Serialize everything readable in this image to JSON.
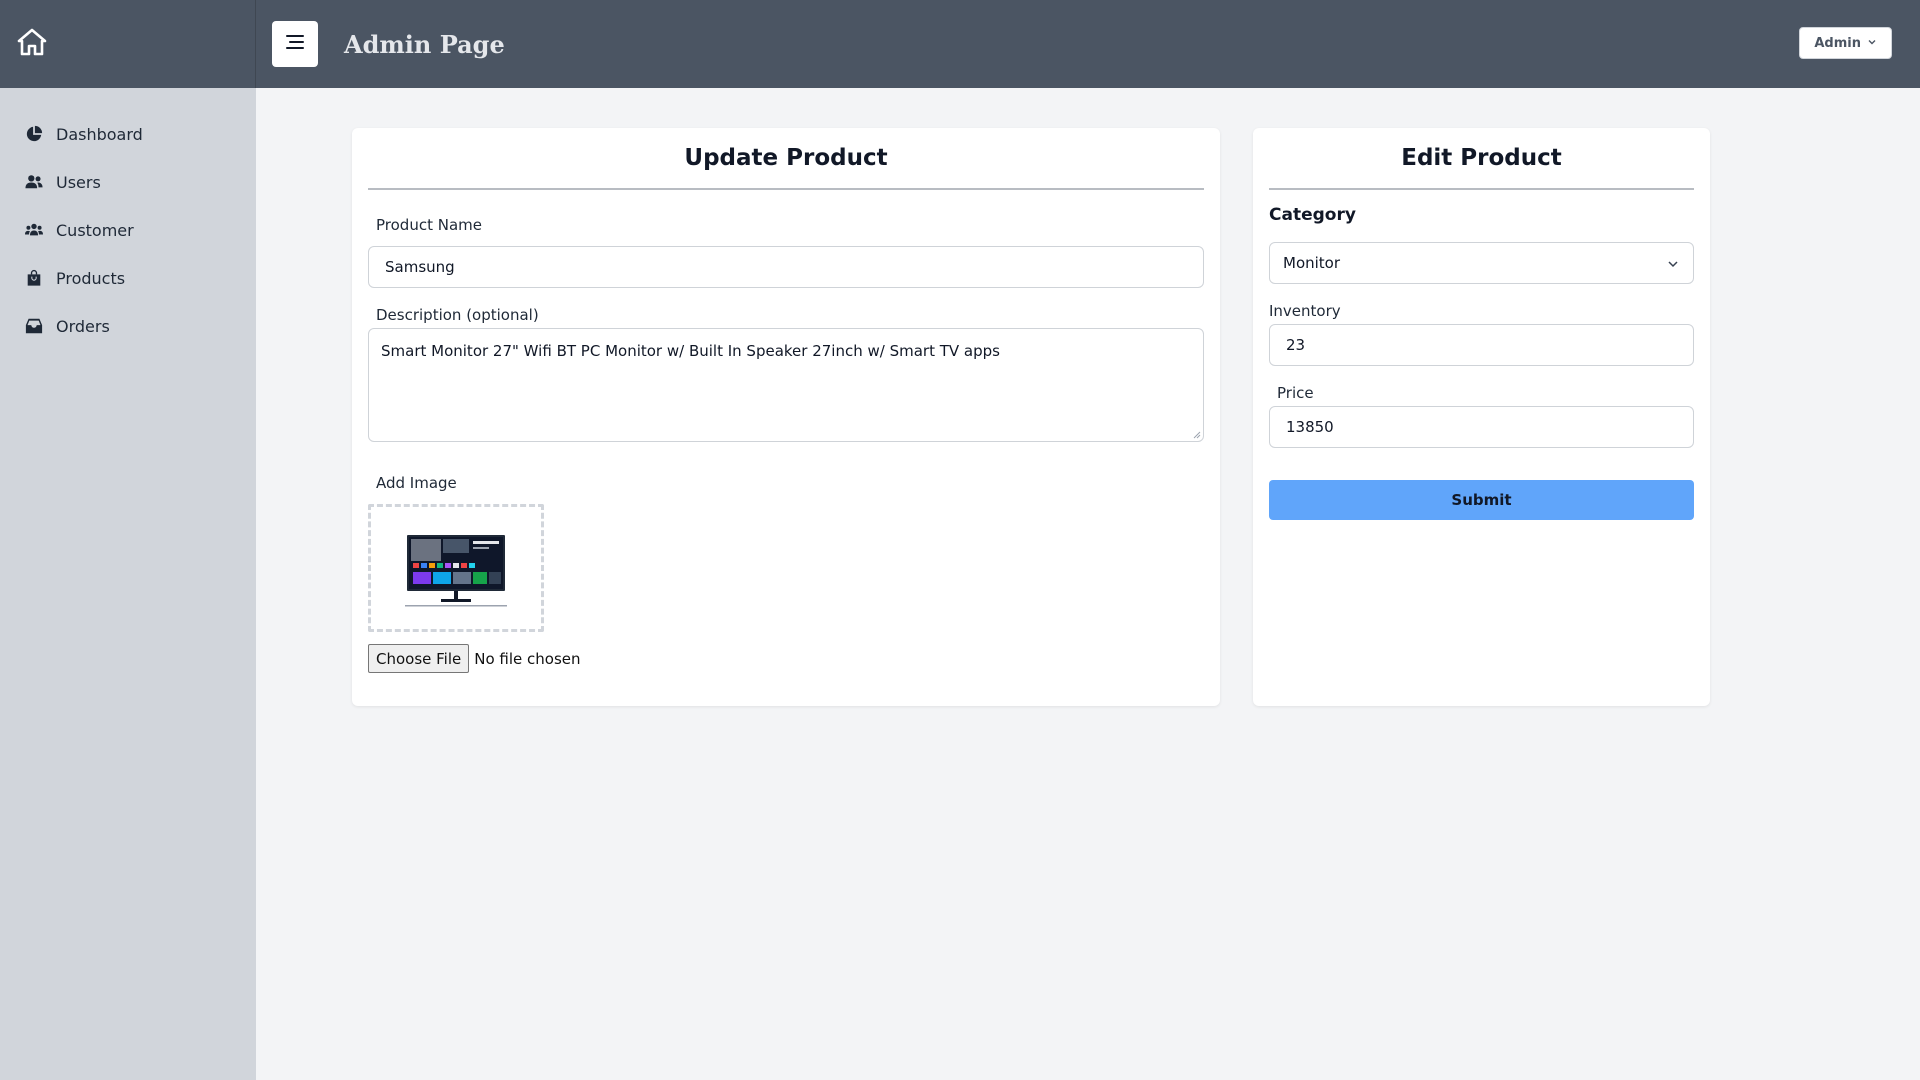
{
  "header": {
    "title": "Admin Page",
    "user_menu_label": "Admin"
  },
  "sidebar": {
    "home_icon": "home-icon",
    "items": [
      {
        "label": "Dashboard",
        "icon": "pie-chart-icon"
      },
      {
        "label": "Users",
        "icon": "users-icon"
      },
      {
        "label": "Customer",
        "icon": "customers-icon"
      },
      {
        "label": "Products",
        "icon": "shopping-bag-icon"
      },
      {
        "label": "Orders",
        "icon": "inbox-icon"
      }
    ]
  },
  "update_product": {
    "title": "Update Product",
    "product_name_label": "Product Name",
    "product_name_value": "Samsung",
    "description_label": "Description (optional)",
    "description_value": "Smart Monitor 27\" Wifi BT PC Monitor w/ Built In Speaker 27inch w/ Smart TV apps",
    "add_image_label": "Add Image",
    "choose_file_label": "Choose File",
    "file_status": "No file chosen"
  },
  "edit_product": {
    "title": "Edit Product",
    "category_label": "Category",
    "category_value": "Monitor",
    "inventory_label": "Inventory",
    "inventory_value": "23",
    "price_label": "Price",
    "price_value": "13850",
    "submit_label": "Submit"
  },
  "colors": {
    "header_bg": "#4b5563",
    "sidebar_bg": "#d1d5db",
    "page_bg": "#f3f4f6",
    "submit_bg": "#60a5fa"
  }
}
